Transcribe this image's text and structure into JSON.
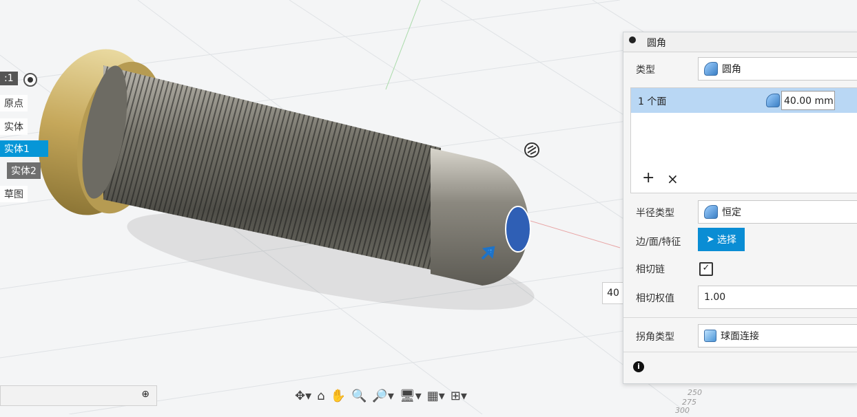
{
  "browser": {
    "scale_label": ":1",
    "origin": "原点",
    "bodies": "实体",
    "body1": "实体1",
    "body2": "实体2",
    "sketch": "草图"
  },
  "panel": {
    "title": "圆角",
    "type_label": "类型",
    "type_value": "圆角",
    "face_count": "1 个面",
    "radius_value": "40.00 mm",
    "add_icon": "+",
    "remove_icon": "×",
    "radius_type_label": "半径类型",
    "radius_type_value": "恒定",
    "edge_face_label": "边/面/特征",
    "select_btn": "选择",
    "tangent_chain_label": "相切链",
    "tangent_weight_label": "相切权值",
    "tangent_weight_value": "1.00",
    "corner_type_label": "拐角类型",
    "corner_type_value": "球面连接"
  },
  "value_box_partial": "40",
  "grid_labels": [
    "250",
    "275",
    "300"
  ],
  "colors": {
    "accent": "#0696d7",
    "face_selected": "#2f5fb5",
    "thread": "#5a5a55",
    "cap": "#c9b270"
  }
}
